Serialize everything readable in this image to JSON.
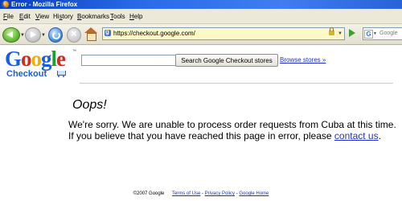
{
  "window": {
    "title": "Error - Mozilla Firefox"
  },
  "menu": {
    "items": [
      {
        "label": "File",
        "accel": "F",
        "rest": "ile"
      },
      {
        "label": "Edit",
        "accel": "E",
        "rest": "dit"
      },
      {
        "label": "View",
        "accel": "V",
        "rest": "iew"
      },
      {
        "label": "History",
        "accel": "s",
        "pre": "Hi",
        "rest": "tory"
      },
      {
        "label": "Bookmarks",
        "accel": "B",
        "rest": "ookmarks"
      },
      {
        "label": "Tools",
        "accel": "T",
        "rest": "ools"
      },
      {
        "label": "Help",
        "accel": "H",
        "rest": "elp"
      }
    ]
  },
  "toolbar": {
    "url": "https://checkout.google.com/",
    "search_placeholder": "Google"
  },
  "logo": {
    "letters": [
      "G",
      "o",
      "o",
      "g",
      "l",
      "e"
    ],
    "sub": "Checkout",
    "tm": "™"
  },
  "store_search": {
    "input_value": "",
    "button_label": "Search Google Checkout stores",
    "browse_label": "Browse stores »"
  },
  "error": {
    "heading": "Oops!",
    "line1": "We're sorry. We are unable to process order requests from Cuba at this time.",
    "line2_prefix": "If you believe that you have reached this page in error, please ",
    "contact_label": "contact us",
    "line2_suffix": "."
  },
  "footer": {
    "copyright": "©2007 Google",
    "terms": "Terms of Use",
    "privacy": "Privacy Policy",
    "home": "Google Home",
    "sep": " - "
  }
}
